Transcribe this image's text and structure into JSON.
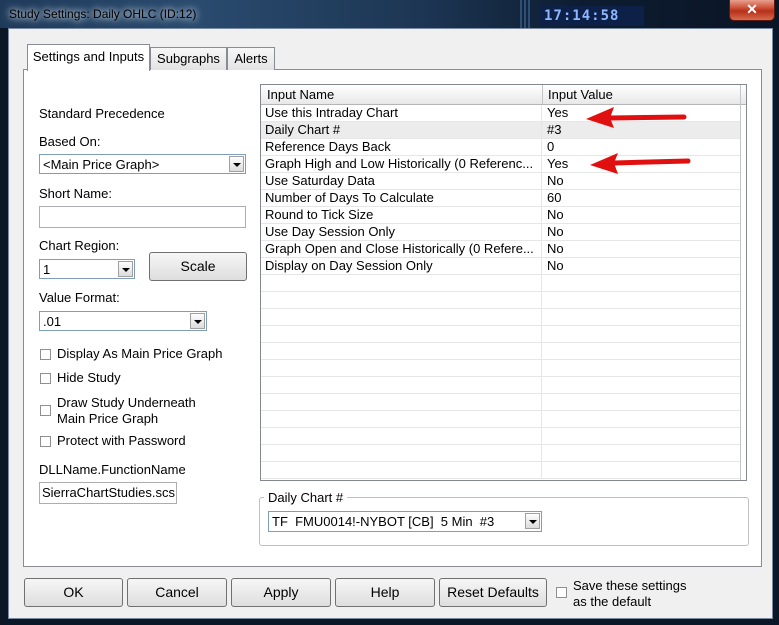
{
  "window": {
    "title": "Study Settings: Daily OHLC (ID:12)",
    "background_clock": "17:14:58",
    "close_symbol": "✕"
  },
  "tabs": [
    "Settings and Inputs",
    "Subgraphs",
    "Alerts"
  ],
  "left": {
    "standard_precedence": "Standard Precedence",
    "based_on_label": "Based On:",
    "based_on_value": "<Main Price Graph>",
    "short_name_label": "Short Name:",
    "short_name_value": "",
    "chart_region_label": "Chart Region:",
    "chart_region_value": "1",
    "scale_button": "Scale",
    "value_format_label": "Value Format:",
    "value_format_value": ".01",
    "checkboxes": [
      {
        "label": "Display As Main Price Graph",
        "checked": false
      },
      {
        "label": "Hide Study",
        "checked": false
      },
      {
        "label": "Draw Study Underneath",
        "label2": "Main Price Graph",
        "checked": false
      },
      {
        "label": "Protect with Password",
        "checked": false
      }
    ],
    "dll_label": "DLLName.FunctionName",
    "dll_value": "SierraChartStudies.scs"
  },
  "grid": {
    "col1_header": "Input Name",
    "col2_header": "Input Value",
    "rows": [
      {
        "name": "Use this Intraday Chart",
        "value": "Yes"
      },
      {
        "name": "Daily Chart #",
        "value": "#3"
      },
      {
        "name": "Reference Days Back",
        "value": "0"
      },
      {
        "name": "Graph High and Low Historically (0 Referenc...",
        "value": "Yes"
      },
      {
        "name": "Use Saturday Data",
        "value": "No"
      },
      {
        "name": "Number of Days To Calculate",
        "value": "60"
      },
      {
        "name": "Round to Tick Size",
        "value": "No"
      },
      {
        "name": "Use Day Session Only",
        "value": "No"
      },
      {
        "name": "Graph Open and Close Historically (0 Refere...",
        "value": "No"
      },
      {
        "name": "Display on Day Session Only",
        "value": "No"
      }
    ]
  },
  "daily_chart": {
    "group_label": "Daily Chart #",
    "value": "TF  FMU0014!-NYBOT [CB]  5 Min  #3"
  },
  "footer": {
    "ok": "OK",
    "cancel": "Cancel",
    "apply": "Apply",
    "help": "Help",
    "reset": "Reset Defaults",
    "save_default_line1": "Save these settings",
    "save_default_line2": "as the default"
  },
  "annotation_color": "#e01010"
}
